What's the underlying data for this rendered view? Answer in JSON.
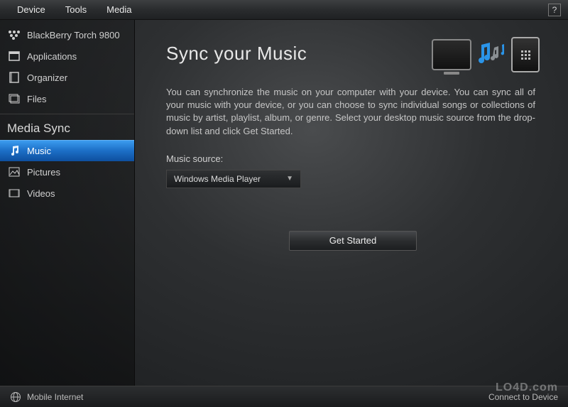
{
  "menu": {
    "device": "Device",
    "tools": "Tools",
    "media": "Media",
    "help_symbol": "?"
  },
  "sidebar": {
    "device_items": [
      {
        "label": "BlackBerry Torch 9800",
        "icon": "blackberry-icon"
      },
      {
        "label": "Applications",
        "icon": "applications-icon"
      },
      {
        "label": "Organizer",
        "icon": "organizer-icon"
      },
      {
        "label": "Files",
        "icon": "files-icon"
      }
    ],
    "media_section_title": "Media Sync",
    "media_items": [
      {
        "label": "Music",
        "icon": "music-icon",
        "selected": true
      },
      {
        "label": "Pictures",
        "icon": "pictures-icon"
      },
      {
        "label": "Videos",
        "icon": "videos-icon"
      }
    ]
  },
  "main": {
    "title": "Sync your Music",
    "description": "You can synchronize the music on your computer with your device.  You can sync all of your music with your device, or you can choose to sync individual songs or collections of music by artist, playlist, album, or genre.  Select your desktop music source from the drop-down list and click Get Started.",
    "music_source_label": "Music source:",
    "music_source_value": "Windows Media Player",
    "get_started_label": "Get Started"
  },
  "statusbar": {
    "mobile_internet": "Mobile Internet",
    "connect_device": "Connect to Device"
  },
  "watermark": "LO4D.com"
}
